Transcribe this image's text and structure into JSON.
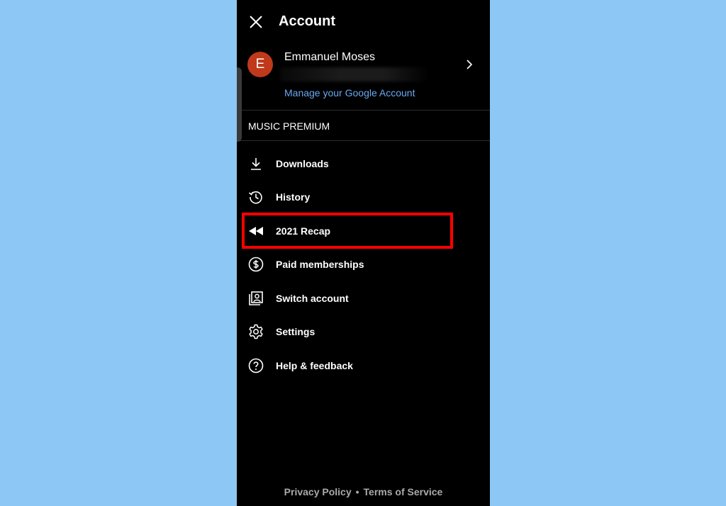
{
  "header": {
    "title": "Account"
  },
  "account": {
    "avatar_letter": "E",
    "name": "Emmanuel Moses",
    "manage_link": "Manage your Google Account"
  },
  "section": {
    "label": "MUSIC PREMIUM"
  },
  "menu": {
    "items": [
      {
        "label": "Downloads",
        "icon": "download-icon"
      },
      {
        "label": "History",
        "icon": "history-icon"
      },
      {
        "label": "2021 Recap",
        "icon": "rewind-icon"
      },
      {
        "label": "Paid memberships",
        "icon": "dollar-icon"
      },
      {
        "label": "Switch account",
        "icon": "switch-account-icon"
      },
      {
        "label": "Settings",
        "icon": "gear-icon"
      },
      {
        "label": "Help & feedback",
        "icon": "help-icon"
      }
    ]
  },
  "footer": {
    "privacy": "Privacy Policy",
    "separator": "•",
    "terms": "Terms of Service"
  },
  "colors": {
    "page_bg": "#8cc7f5",
    "app_bg": "#000000",
    "link": "#6aa8f0",
    "avatar": "#c0391b",
    "highlight": "#ff0000"
  }
}
